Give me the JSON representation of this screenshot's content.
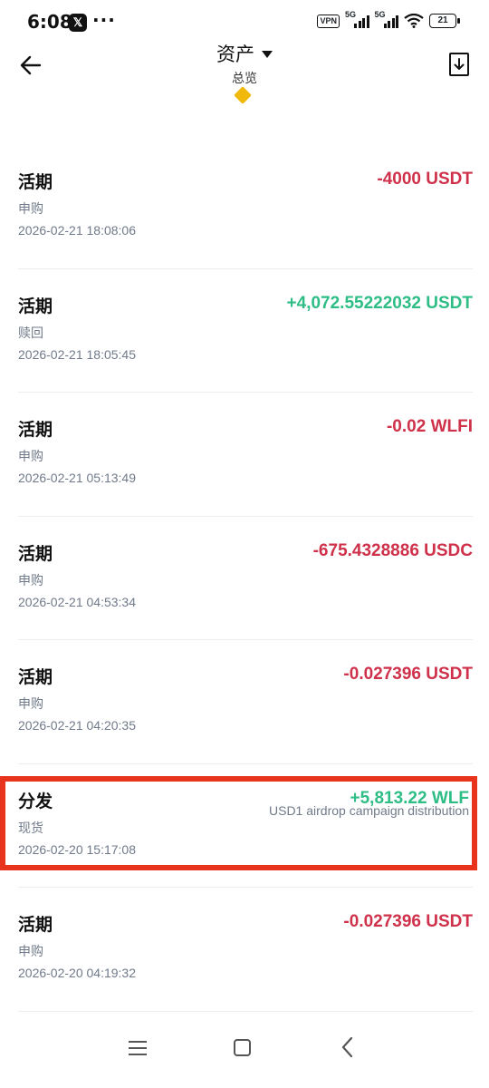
{
  "status_bar": {
    "time": "6:08",
    "x_label": "𝕏",
    "more": "···",
    "vpn": "VPN",
    "sim1": "5G",
    "sim2": "5G",
    "battery": "21"
  },
  "header": {
    "title": "资产",
    "subtitle": "总览",
    "accent_color": "#F0B90B"
  },
  "transactions": [
    {
      "type": "活期",
      "sub": "申购",
      "time": "2026-02-21 18:08:06",
      "amount": "-4000 USDT",
      "direction": "out",
      "note": ""
    },
    {
      "type": "活期",
      "sub": "赎回",
      "time": "2026-02-21 18:05:45",
      "amount": "+4,072.55222032 USDT",
      "direction": "in",
      "note": ""
    },
    {
      "type": "活期",
      "sub": "申购",
      "time": "2026-02-21 05:13:49",
      "amount": "-0.02 WLFI",
      "direction": "out",
      "note": ""
    },
    {
      "type": "活期",
      "sub": "申购",
      "time": "2026-02-21 04:53:34",
      "amount": "-675.4328886 USDC",
      "direction": "out",
      "note": ""
    },
    {
      "type": "活期",
      "sub": "申购",
      "time": "2026-02-21 04:20:35",
      "amount": "-0.027396 USDT",
      "direction": "out",
      "note": ""
    },
    {
      "type": "分发",
      "sub": "现货",
      "time": "2026-02-20 15:17:08",
      "amount": "+5,813.22 WLF",
      "direction": "in",
      "note": "USD1 airdrop campaign distribution"
    },
    {
      "type": "活期",
      "sub": "申购",
      "time": "2026-02-20 04:19:32",
      "amount": "-0.027396 USDT",
      "direction": "out",
      "note": ""
    }
  ],
  "colors": {
    "negative": "#CF304A",
    "positive": "#2EBD85",
    "highlight_box": "#E8341C"
  },
  "icons": {
    "back": "arrow-left-icon",
    "title_dropdown": "caret-down-icon",
    "download": "download-icon",
    "nav_menu": "menu-icon",
    "nav_home": "home-square-icon",
    "nav_back": "chevron-left-icon"
  }
}
